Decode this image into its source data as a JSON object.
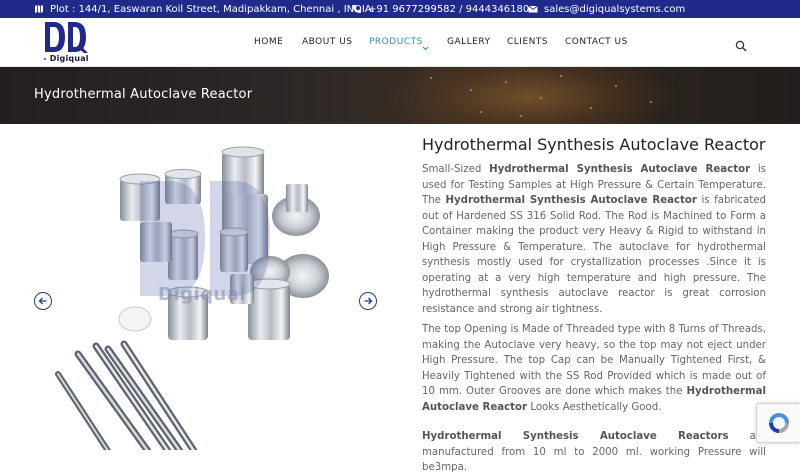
{
  "topbar": {
    "address": "Plot : 144/1, Easwaran Koil Street, Madipakkam, Chennai , INDIA.",
    "phone": "+91 9677299582 / 9444346180",
    "email": "sales@digiqualsystems.com"
  },
  "logo": {
    "brand": "- Digiqual -"
  },
  "nav": {
    "items": [
      "HOME",
      "ABOUT US",
      "PRODUCTS",
      "GALLERY",
      "CLIENTS",
      "CONTACT US"
    ],
    "active": "PRODUCTS"
  },
  "banner": {
    "title": "Hydrothermal Autoclave Reactor"
  },
  "gallery": {
    "watermark": "Digiqual"
  },
  "product": {
    "heading": "Hydrothermal Synthesis Autoclave Reactor",
    "p1": {
      "a": "Small-Sized ",
      "b": "Hydrothermal Synthesis Autoclave Reactor",
      "c": " is used for Testing Samples at High Pressure & Certain Temperature. The ",
      "d": "Hydrothermal Synthesis Autoclave Reactor",
      "e": " is fabricated out of Hardened SS 316 Solid Rod. The Rod is Machined to Form a Container making the product very Heavy & Rigid to withstand in High Pressure & Temperature. The autoclave for hydrothermal synthesis mostly used for crystallization processes .Since it is operating at a very high temperature and high pressure.  The hydrothermal synthesis autoclave reactor is great corrosion resistance and strong air tightness."
    },
    "p2": {
      "a": "The top Opening is Made of Threaded type with 8 Turns of Threads, making the Autoclave very heavy, so the top may not eject under High Pressure.  The top Cap can be Manually Tightened First, & Heavily Tightened with the SS Rod Provided which is made out of 10 mm.  Outer Grooves are done which makes the ",
      "b": "Hydrothermal Autoclave Reactor",
      "c": " Looks Aesthetically Good."
    },
    "p3": {
      "a": "Hydrothermal Synthesis Autoclave Reactors",
      "b": " are manufactured from 10 ml to 2000 ml. working Pressure will be3mpa."
    }
  },
  "colors": {
    "topbar": "#1f2a8a",
    "accent": "#2a8fd0",
    "arrow": "#1f3a93"
  }
}
